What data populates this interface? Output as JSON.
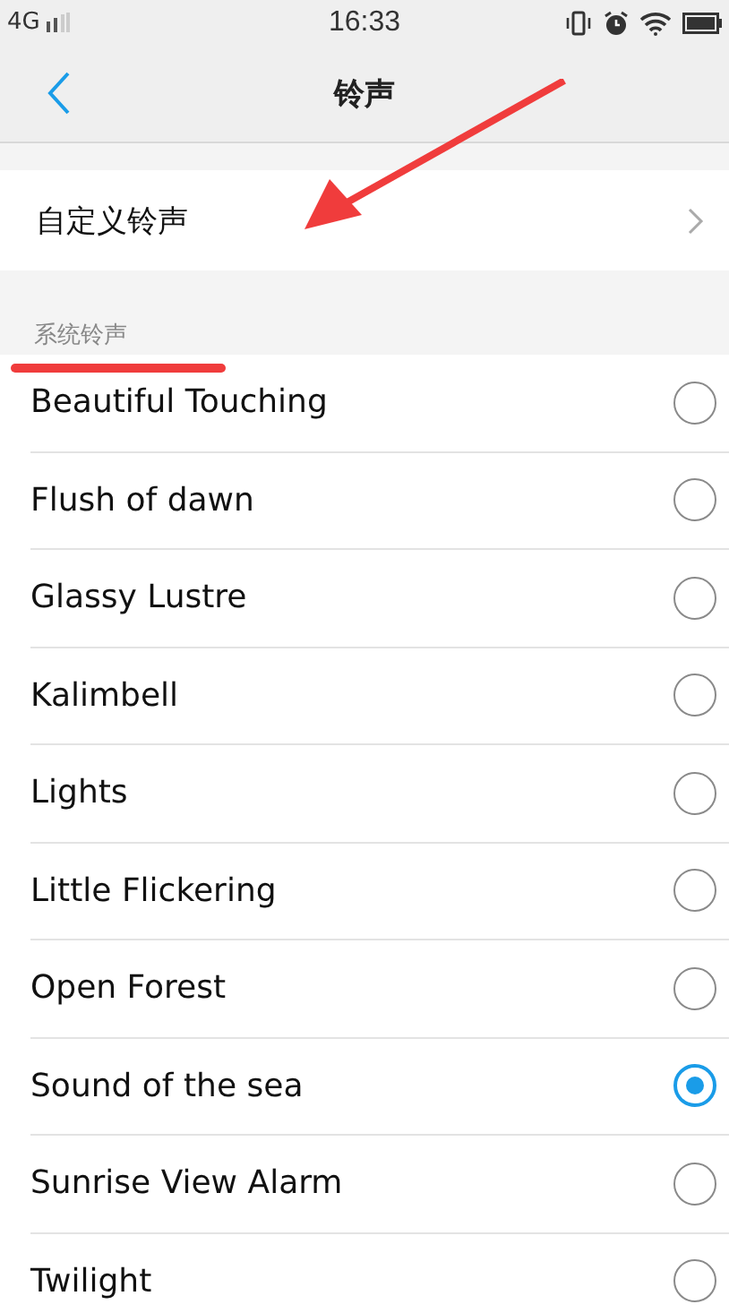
{
  "status_bar": {
    "network": "4G",
    "time": "16:33"
  },
  "header": {
    "title": "铃声"
  },
  "custom_item": {
    "label": "自定义铃声"
  },
  "section": {
    "title": "系统铃声"
  },
  "ringtones": [
    {
      "name": "Beautiful Touching",
      "selected": false
    },
    {
      "name": "Flush of dawn",
      "selected": false
    },
    {
      "name": "Glassy Lustre",
      "selected": false
    },
    {
      "name": "Kalimbell",
      "selected": false
    },
    {
      "name": "Lights",
      "selected": false
    },
    {
      "name": "Little Flickering",
      "selected": false
    },
    {
      "name": "Open Forest",
      "selected": false
    },
    {
      "name": "Sound of the sea",
      "selected": true
    },
    {
      "name": "Sunrise View Alarm",
      "selected": false
    },
    {
      "name": "Twilight",
      "selected": false
    }
  ]
}
